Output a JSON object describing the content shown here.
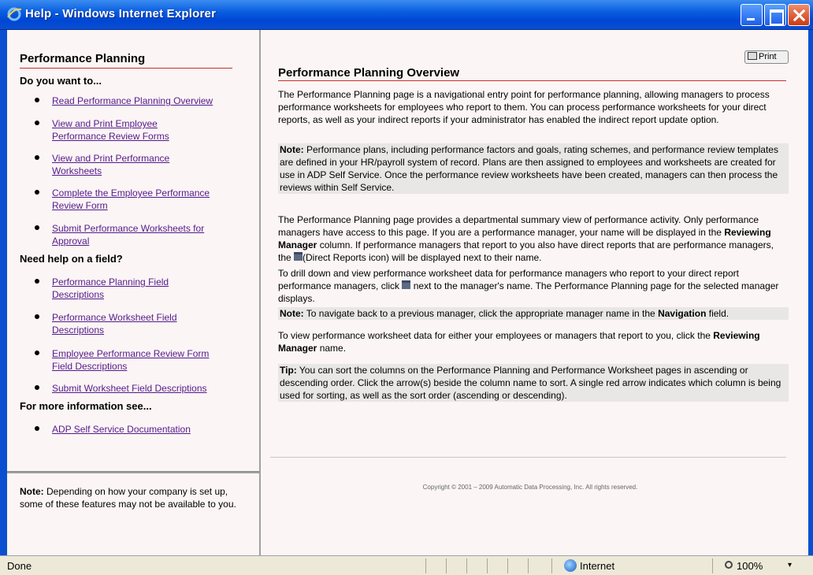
{
  "window": {
    "title": "Help - Windows Internet Explorer"
  },
  "left": {
    "title": "Performance Planning",
    "section1": "Do you want to...",
    "links1": [
      {
        "line1": "Read Performance Planning Overview",
        "line2": ""
      },
      {
        "line1": "View and Print Employee",
        "line2": "Performance Review Forms"
      },
      {
        "line1": "View and Print Performance",
        "line2": "Worksheets"
      },
      {
        "line1": "Complete the Employee Performance",
        "line2": "Review Form"
      },
      {
        "line1": "Submit Performance Worksheets for",
        "line2": "Approval"
      }
    ],
    "section2": "Need help on a field?",
    "links2": [
      {
        "line1": "Performance Planning Field",
        "line2": "Descriptions"
      },
      {
        "line1": "Performance Worksheet Field",
        "line2": "Descriptions"
      },
      {
        "line1": "Employee Performance Review Form",
        "line2": "Field Descriptions"
      },
      {
        "line1": "Submit Worksheet Field Descriptions",
        "line2": ""
      }
    ],
    "section3": "For more information see...",
    "links3": [
      {
        "line1": "ADP Self Service Documentation",
        "line2": ""
      }
    ],
    "note_label": "Note:",
    "note_text": " Depending on how your company is set up, some of these features may not be available to you."
  },
  "right": {
    "print_label": "Print",
    "title": "Performance Planning Overview",
    "p1": "The Performance Planning page is a navigational entry point for performance planning, allowing managers to process performance worksheets for employees who report to them. You can process performance worksheets for your direct reports, as well as your indirect reports if your administrator has enabled the indirect report update option.",
    "note1_label": "Note:",
    "note1_text": " Performance plans, including performance factors and goals, rating schemes, and performance review templates are defined in your HR/payroll system of record. Plans are then assigned to employees and worksheets are created for use in ADP Self Service. Once the performance review worksheets have been created, managers can then process the reviews within Self Service.",
    "p2_a": "The Performance Planning page provides a departmental summary view of performance activity. Only performance managers have access to this page. If you are a performance manager, your name will be displayed in the ",
    "p2_b": "Reviewing Manager",
    "p2_c": " column. If performance managers that report to you also have direct reports that are performance managers, the ",
    "p2_d": "(Direct Reports icon) will be displayed next to their name.",
    "p3_a": "To drill down and view performance worksheet data for performance managers who report to your direct report performance managers, click ",
    "p3_b": " next to the manager's name. The Performance Planning page for the selected manager displays.",
    "note2_label": "Note:",
    "note2_a": " To navigate back to a previous manager, click the appropriate manager name in the ",
    "note2_b": "Navigation",
    "note2_c": " field.",
    "p4_a": "To view performance worksheet data for either your employees or managers that report to you, click the ",
    "p4_b": "Reviewing Manager",
    "p4_c": " name.",
    "tip_label": "Tip:",
    "tip_text": " You can sort the columns on the Performance Planning and Performance Worksheet pages in ascending or descending order. Click the arrow(s) beside the column name to sort. A single red arrow indicates which column is being used for sorting, as well as the sort order (ascending or descending).",
    "copyright": "Copyright © 2001 – 2009 Automatic Data Processing, Inc. All rights reserved."
  },
  "status": {
    "text": "Done",
    "zone": "Internet",
    "zoom": "100%"
  }
}
